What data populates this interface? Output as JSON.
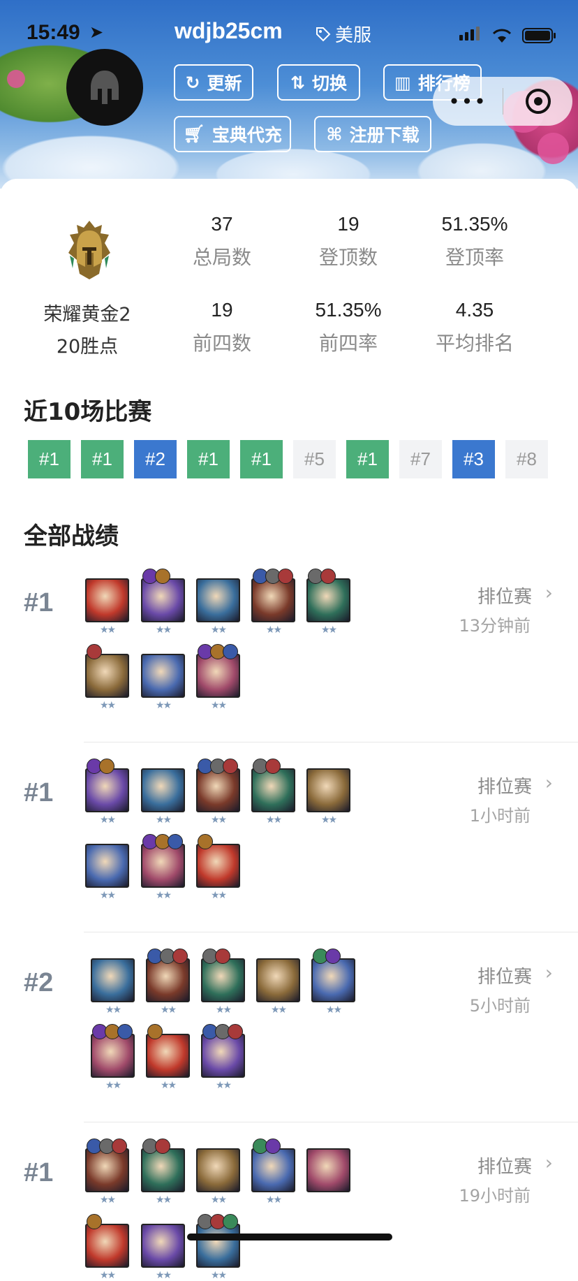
{
  "status": {
    "time": "15:49"
  },
  "header": {
    "username": "wdjb25cm",
    "region": "美服",
    "buttons": {
      "refresh": "更新",
      "switch": "切换",
      "leaderboard": "排行榜",
      "recharge": "宝典代充",
      "register": "注册下载"
    }
  },
  "profile": {
    "tier": "荣耀黄金2",
    "points": "20胜点",
    "stats": [
      {
        "value": "37",
        "label": "总局数"
      },
      {
        "value": "19",
        "label": "登顶数"
      },
      {
        "value": "51.35%",
        "label": "登顶率"
      },
      {
        "value": "19",
        "label": "前四数"
      },
      {
        "value": "51.35%",
        "label": "前四率"
      },
      {
        "value": "4.35",
        "label": "平均排名"
      }
    ]
  },
  "recent": {
    "title": "近10场比赛",
    "results": [
      {
        "text": "#1",
        "style": "green"
      },
      {
        "text": "#1",
        "style": "green"
      },
      {
        "text": "#2",
        "style": "blue"
      },
      {
        "text": "#1",
        "style": "green"
      },
      {
        "text": "#1",
        "style": "green"
      },
      {
        "text": "#5",
        "style": "gray"
      },
      {
        "text": "#1",
        "style": "green"
      },
      {
        "text": "#7",
        "style": "gray"
      },
      {
        "text": "#3",
        "style": "blue"
      },
      {
        "text": "#8",
        "style": "gray"
      }
    ]
  },
  "history": {
    "title": "全部战绩",
    "matches": [
      {
        "place": "#1",
        "mode": "排位赛",
        "ago": "13分钟前"
      },
      {
        "place": "#1",
        "mode": "排位赛",
        "ago": "1小时前"
      },
      {
        "place": "#2",
        "mode": "排位赛",
        "ago": "5小时前"
      },
      {
        "place": "#1",
        "mode": "排位赛",
        "ago": "19小时前"
      }
    ]
  },
  "colors": {
    "win": "#4caf7a",
    "top": "#3b78cf",
    "neutral": "#f2f3f5"
  }
}
